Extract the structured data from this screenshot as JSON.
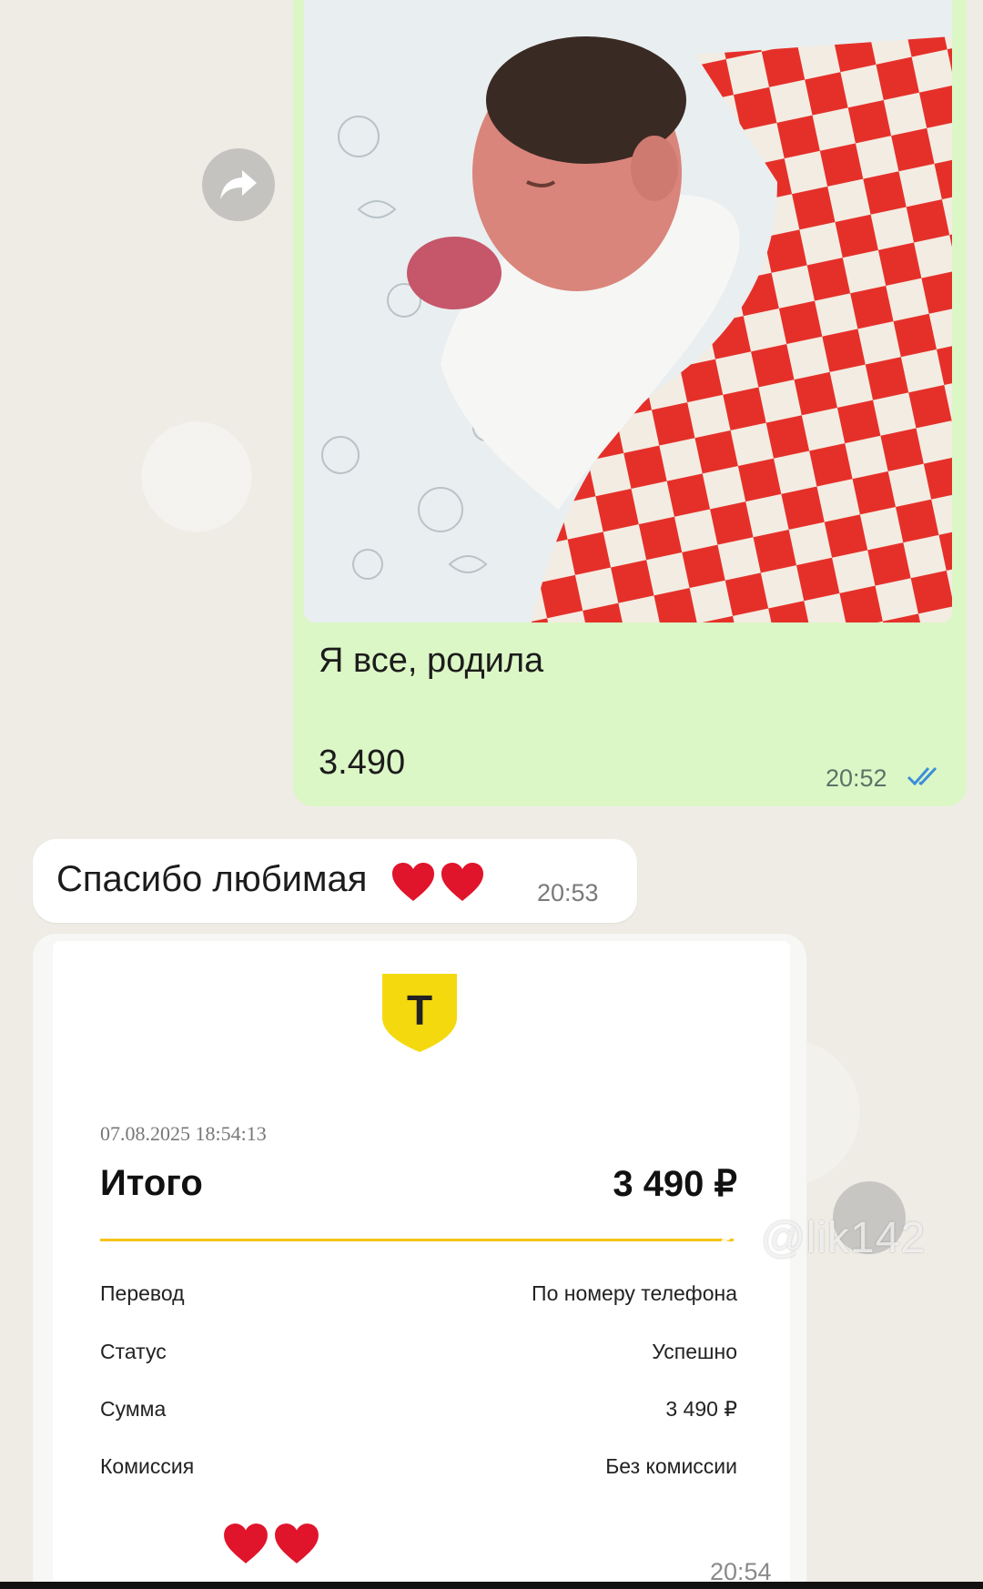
{
  "chat": {
    "outgoing_photo_message": {
      "caption": "Я все, родила",
      "amount": "3.490",
      "time": "20:52",
      "status_icon": "double-check-icon"
    },
    "incoming_message": {
      "text": "Спасибо любимая",
      "emoji": "heart-emoji",
      "time": "20:53"
    },
    "receipt_message": {
      "bank_logo_letter": "Т",
      "date": "07.08.2025 18:54:13",
      "total_label": "Итого",
      "total_value": "3 490 ₽",
      "rows": [
        {
          "label": "Перевод",
          "value": "По номеру телефона"
        },
        {
          "label": "Статус",
          "value": "Успешно"
        },
        {
          "label": "Сумма",
          "value": "3 490 ₽"
        },
        {
          "label": "Комиссия",
          "value": "Без комиссии"
        }
      ],
      "time": "20:54"
    },
    "share_icon": "share-arrow-icon"
  },
  "watermark": {
    "text": "@lik142",
    "icon": "tiktok-icon"
  },
  "colors": {
    "outgoing_bubble": "#dcf7c6",
    "incoming_bubble": "#ffffff",
    "bank_yellow": "#f5c518",
    "heart_red": "#e0142b",
    "read_tick_blue": "#3b8fd9"
  }
}
